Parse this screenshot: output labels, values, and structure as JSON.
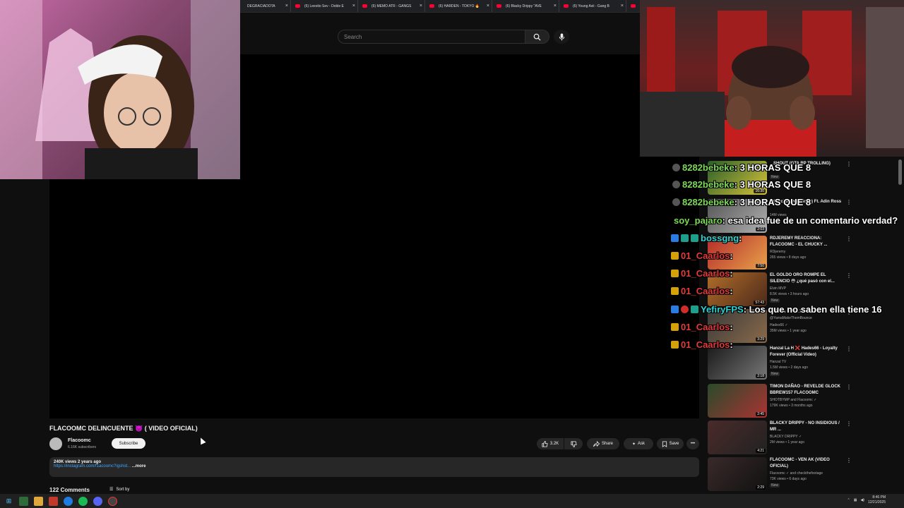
{
  "browser": {
    "tabs": [
      {
        "label": "DEGRACIADOTA"
      },
      {
        "label": "(6) Leexito Sev - Doble E"
      },
      {
        "label": "(6) MEMO ATR - GANGS"
      },
      {
        "label": "(6) HARDEN - TOKYO 🔥"
      },
      {
        "label": "(6) Blacky Drippy \"AVE"
      },
      {
        "label": "(6) Young Avii - Gang B"
      },
      {
        "label": "(6"
      }
    ]
  },
  "masthead": {
    "search_placeholder": "Search"
  },
  "video": {
    "title": "FLACOOMC DELINCUENTE 👿 ( VIDEO OFICIAL)",
    "channel": "Flacoomc",
    "subscribers": "6.16K subscribers",
    "subscribe_label": "Subscribe",
    "likes": "3.2K",
    "share_label": "Share",
    "ask_label": "Ask",
    "save_label": "Save",
    "views_date": "240K views  2 years ago",
    "link": "https://instagram.com/f1acoomc?igshid...",
    "more_label": "...more",
    "comments": "122 Comments",
    "sort_label": "Sort by"
  },
  "recommendations": [
    {
      "title": "...SHOUT (GTA RP TROLLING)",
      "channel": "",
      "meta": "",
      "badge": "New",
      "duration": "16:30"
    },
    {
      "title": "...Official Lyric Video) Ft. Adin Ross",
      "channel": "",
      "meta": "14M views",
      "badge": "",
      "duration": "2:03"
    },
    {
      "title": "RDJEREMY REACCIONA: FLACOOMC - EL CHUCKY ...",
      "channel": "RDjeremy",
      "meta": "265 views • 8 days ago",
      "badge": "",
      "duration": "7:50"
    },
    {
      "title": "EL GOLDO ORO ROMPE EL SILENCIO 😳 ¿qué pasó con el...",
      "channel": "Elvin MVP",
      "meta": "8.5K views • 3 hours ago",
      "badge": "New",
      "duration": "57:43"
    },
    {
      "title": "ULTIMA CENA X",
      "channel": "@YamaMakeThemBounce",
      "meta": "Hades66 ✓",
      "badge": "",
      "duration": "3:29",
      "meta2": "35M views • 1 year ago"
    },
    {
      "title": "Hanzal La H ❌ Hades66 - Loyalty Forever (Official Video)",
      "channel": "Hanzal TV",
      "meta": "1.5M views • 2 days ago",
      "badge": "New",
      "duration": "2:18"
    },
    {
      "title": "TIMON DAÑAO - REVELDE GLOCK BBREW157 FLACOOMC",
      "channel": "SHOTBYMP and Flacoomc ✓",
      "meta": "179K views • 3 months ago",
      "badge": "",
      "duration": "2:45"
    },
    {
      "title": "BLACKY DRIPPY - NO INSIDIOUS / MR ...",
      "channel": "BLACKY DRIPPY ✓",
      "meta": "2M views • 1 year ago",
      "badge": "",
      "duration": "4:21"
    },
    {
      "title": "FLACOOMC - VEN AK (VIDEO OFICIAL)",
      "channel": "Flacoomc ✓ and checkthefootage",
      "meta": "73K views • 6 days ago",
      "badge": "New",
      "duration": "2:29"
    }
  ],
  "chat": [
    {
      "user": "8282bebeke",
      "text": ": 3 HORAS QUE 8",
      "user_color": "green",
      "badge": "grey"
    },
    {
      "user": "8282bebeke",
      "text": ": 3 HORAS QUE 8",
      "user_color": "green",
      "badge": "grey"
    },
    {
      "user": "8282bebeke",
      "text": ": 3 HORAS QUE 8",
      "user_color": "green",
      "badge": "grey"
    },
    {
      "user": "soy_pajaro",
      "text": ": esa idea fue de un comentario verdad?",
      "user_color": "green",
      "badge": ""
    },
    {
      "user": "bossgng",
      "text": ":",
      "user_color": "cyan",
      "badge": "blue"
    },
    {
      "user": "01_Caarlos",
      "text": ":",
      "user_color": "red",
      "badge": "gold"
    },
    {
      "user": "01_Caarlos",
      "text": ":",
      "user_color": "red",
      "badge": "gold"
    },
    {
      "user": "01_Caarlos",
      "text": ":",
      "user_color": "red",
      "badge": "gold"
    },
    {
      "user": "YefiryFPS",
      "text": ": Los que no saben ella tiene 16",
      "user_color": "cyan",
      "badge": "blue"
    },
    {
      "user": "01_Caarlos",
      "text": ":",
      "user_color": "red",
      "badge": "gold"
    },
    {
      "user": "01_Caarlos",
      "text": ":",
      "user_color": "red",
      "badge": "gold"
    }
  ],
  "taskbar": {
    "time": "8:46 PM",
    "date": "12/21/2025"
  },
  "colors": {
    "yt_bg": "#0f0f0f",
    "chip_bg": "#272727",
    "link_blue": "#3ea6ff",
    "yt_red": "#ff0033"
  }
}
